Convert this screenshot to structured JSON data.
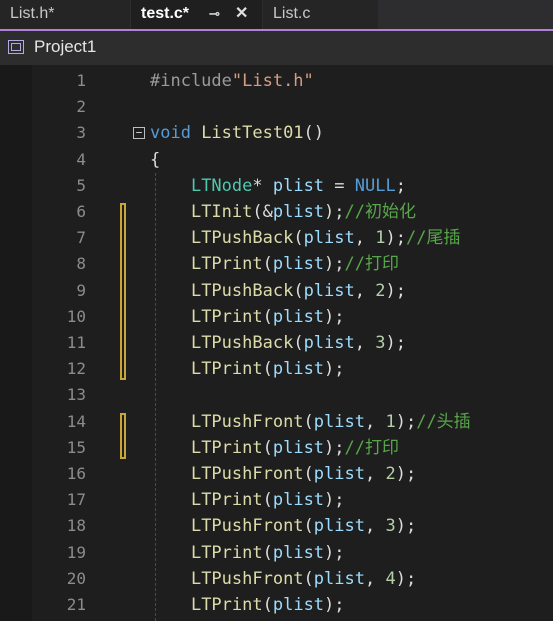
{
  "tabs": [
    {
      "label": "List.h*",
      "state": "inactive"
    },
    {
      "label": "test.c*",
      "state": "active",
      "pin_icon": "pin-icon",
      "close_icon": "close-icon",
      "pin_glyph": "⊸",
      "close_glyph": "✕"
    },
    {
      "label": "List.c",
      "state": "inactive"
    }
  ],
  "project": {
    "name": "Project1",
    "icon": "project-icon"
  },
  "editor": {
    "line_numbers": [
      "1",
      "2",
      "3",
      "4",
      "5",
      "6",
      "7",
      "8",
      "9",
      "10",
      "11",
      "12",
      "13",
      "14",
      "15",
      "16",
      "17",
      "18",
      "19",
      "20",
      "21"
    ],
    "fold_glyph": "⊟",
    "lines": [
      [
        {
          "t": "pp",
          "v": "#include"
        },
        {
          "t": "str",
          "v": "\"List.h\""
        }
      ],
      [],
      [
        {
          "t": "kw",
          "v": "void "
        },
        {
          "t": "fn",
          "v": "ListTest01"
        },
        {
          "t": "txt",
          "v": "()"
        }
      ],
      [
        {
          "t": "txt",
          "v": "{"
        }
      ],
      [
        {
          "t": "txt",
          "v": "    "
        },
        {
          "t": "type",
          "v": "LTNode"
        },
        {
          "t": "txt",
          "v": "* "
        },
        {
          "t": "var",
          "v": "plist"
        },
        {
          "t": "txt",
          "v": " = "
        },
        {
          "t": "kw",
          "v": "NULL"
        },
        {
          "t": "txt",
          "v": ";"
        }
      ],
      [
        {
          "t": "txt",
          "v": "    "
        },
        {
          "t": "fn",
          "v": "LTInit"
        },
        {
          "t": "txt",
          "v": "(&"
        },
        {
          "t": "var",
          "v": "plist"
        },
        {
          "t": "txt",
          "v": ");"
        },
        {
          "t": "cm",
          "v": "//初始化"
        }
      ],
      [
        {
          "t": "txt",
          "v": "    "
        },
        {
          "t": "fn",
          "v": "LTPushBack"
        },
        {
          "t": "txt",
          "v": "("
        },
        {
          "t": "var",
          "v": "plist"
        },
        {
          "t": "txt",
          "v": ", "
        },
        {
          "t": "num",
          "v": "1"
        },
        {
          "t": "txt",
          "v": ");"
        },
        {
          "t": "cm",
          "v": "//尾插"
        }
      ],
      [
        {
          "t": "txt",
          "v": "    "
        },
        {
          "t": "fn",
          "v": "LTPrint"
        },
        {
          "t": "txt",
          "v": "("
        },
        {
          "t": "var",
          "v": "plist"
        },
        {
          "t": "txt",
          "v": ");"
        },
        {
          "t": "cm",
          "v": "//打印"
        }
      ],
      [
        {
          "t": "txt",
          "v": "    "
        },
        {
          "t": "fn",
          "v": "LTPushBack"
        },
        {
          "t": "txt",
          "v": "("
        },
        {
          "t": "var",
          "v": "plist"
        },
        {
          "t": "txt",
          "v": ", "
        },
        {
          "t": "num",
          "v": "2"
        },
        {
          "t": "txt",
          "v": ");"
        }
      ],
      [
        {
          "t": "txt",
          "v": "    "
        },
        {
          "t": "fn",
          "v": "LTPrint"
        },
        {
          "t": "txt",
          "v": "("
        },
        {
          "t": "var",
          "v": "plist"
        },
        {
          "t": "txt",
          "v": ");"
        }
      ],
      [
        {
          "t": "txt",
          "v": "    "
        },
        {
          "t": "fn",
          "v": "LTPushBack"
        },
        {
          "t": "txt",
          "v": "("
        },
        {
          "t": "var",
          "v": "plist"
        },
        {
          "t": "txt",
          "v": ", "
        },
        {
          "t": "num",
          "v": "3"
        },
        {
          "t": "txt",
          "v": ");"
        }
      ],
      [
        {
          "t": "txt",
          "v": "    "
        },
        {
          "t": "fn",
          "v": "LTPrint"
        },
        {
          "t": "txt",
          "v": "("
        },
        {
          "t": "var",
          "v": "plist"
        },
        {
          "t": "txt",
          "v": ");"
        }
      ],
      [],
      [
        {
          "t": "txt",
          "v": "    "
        },
        {
          "t": "fn",
          "v": "LTPushFront"
        },
        {
          "t": "txt",
          "v": "("
        },
        {
          "t": "var",
          "v": "plist"
        },
        {
          "t": "txt",
          "v": ", "
        },
        {
          "t": "num",
          "v": "1"
        },
        {
          "t": "txt",
          "v": ");"
        },
        {
          "t": "cm",
          "v": "//头插"
        }
      ],
      [
        {
          "t": "txt",
          "v": "    "
        },
        {
          "t": "fn",
          "v": "LTPrint"
        },
        {
          "t": "txt",
          "v": "("
        },
        {
          "t": "var",
          "v": "plist"
        },
        {
          "t": "txt",
          "v": ");"
        },
        {
          "t": "cm",
          "v": "//打印"
        }
      ],
      [
        {
          "t": "txt",
          "v": "    "
        },
        {
          "t": "fn",
          "v": "LTPushFront"
        },
        {
          "t": "txt",
          "v": "("
        },
        {
          "t": "var",
          "v": "plist"
        },
        {
          "t": "txt",
          "v": ", "
        },
        {
          "t": "num",
          "v": "2"
        },
        {
          "t": "txt",
          "v": ");"
        }
      ],
      [
        {
          "t": "txt",
          "v": "    "
        },
        {
          "t": "fn",
          "v": "LTPrint"
        },
        {
          "t": "txt",
          "v": "("
        },
        {
          "t": "var",
          "v": "plist"
        },
        {
          "t": "txt",
          "v": ");"
        }
      ],
      [
        {
          "t": "txt",
          "v": "    "
        },
        {
          "t": "fn",
          "v": "LTPushFront"
        },
        {
          "t": "txt",
          "v": "("
        },
        {
          "t": "var",
          "v": "plist"
        },
        {
          "t": "txt",
          "v": ", "
        },
        {
          "t": "num",
          "v": "3"
        },
        {
          "t": "txt",
          "v": ");"
        }
      ],
      [
        {
          "t": "txt",
          "v": "    "
        },
        {
          "t": "fn",
          "v": "LTPrint"
        },
        {
          "t": "txt",
          "v": "("
        },
        {
          "t": "var",
          "v": "plist"
        },
        {
          "t": "txt",
          "v": ");"
        }
      ],
      [
        {
          "t": "txt",
          "v": "    "
        },
        {
          "t": "fn",
          "v": "LTPushFront"
        },
        {
          "t": "txt",
          "v": "("
        },
        {
          "t": "var",
          "v": "plist"
        },
        {
          "t": "txt",
          "v": ", "
        },
        {
          "t": "num",
          "v": "4"
        },
        {
          "t": "txt",
          "v": ");"
        }
      ],
      [
        {
          "t": "txt",
          "v": "    "
        },
        {
          "t": "fn",
          "v": "LTPrint"
        },
        {
          "t": "txt",
          "v": "("
        },
        {
          "t": "var",
          "v": "plist"
        },
        {
          "t": "txt",
          "v": ");"
        }
      ]
    ],
    "change_marker_lines": [
      [
        6,
        12
      ],
      [
        14,
        15
      ]
    ],
    "fold_line": 3
  },
  "colors": {
    "background": "#1e1e1e",
    "accent": "#b180d7",
    "change_marker": "#c8a63c",
    "type": "#4ec9b0",
    "keyword": "#569cd6",
    "function": "#dcdcaa",
    "variable": "#9cdcfe",
    "comment": "#57a64a",
    "string": "#d69d85"
  }
}
